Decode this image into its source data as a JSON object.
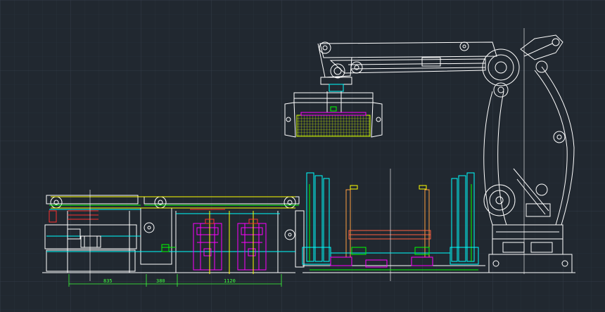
{
  "viewport": {
    "background": "#212830",
    "grid_color": "#2c3541",
    "grid_major_color": "#333d4a"
  },
  "colors": {
    "white": "#ffffff",
    "cyan": "#00ffff",
    "magenta": "#ff00ff",
    "yellow": "#ffff00",
    "green": "#00ff00",
    "red": "#ff3030",
    "dim_green": "#3cff3c",
    "orange": "#ffa040"
  },
  "dimensions": [
    {
      "id": "dim-1",
      "label": "835"
    },
    {
      "id": "dim-2",
      "label": "380"
    },
    {
      "id": "dim-3",
      "label": "1120"
    }
  ]
}
